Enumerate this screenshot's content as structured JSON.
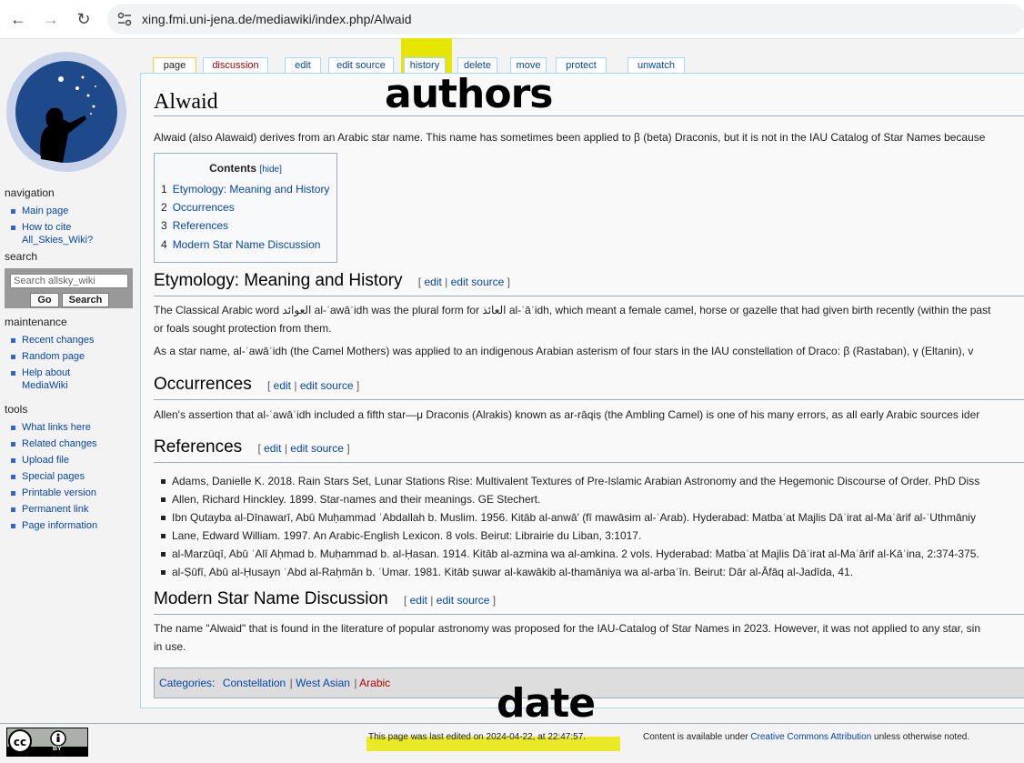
{
  "browser": {
    "url": "xing.fmi.uni-jena.de/mediawiki/index.php/Alwaid",
    "back_icon": "←",
    "forward_icon": "→",
    "reload_icon": "↻"
  },
  "sidebar": {
    "navigation_heading": "navigation",
    "navigation": [
      "Main page",
      "How to cite All_Skies_Wiki?"
    ],
    "search_heading": "search",
    "search_placeholder": "Search allsky_wiki",
    "go_label": "Go",
    "search_label": "Search",
    "maintenance_heading": "maintenance",
    "maintenance": [
      "Recent changes",
      "Random page",
      "Help about MediaWiki"
    ],
    "tools_heading": "tools",
    "tools": [
      "What links here",
      "Related changes",
      "Upload file",
      "Special pages",
      "Printable version",
      "Permanent link",
      "Page information"
    ]
  },
  "tabs": {
    "page": "page",
    "discussion": "discussion",
    "edit": "edit",
    "edit_source": "edit source",
    "history": "history",
    "delete": "delete",
    "move": "move",
    "protect": "protect",
    "unwatch": "unwatch"
  },
  "annotations": {
    "authors": "authors",
    "date": "date"
  },
  "article": {
    "title": "Alwaid",
    "intro": "Alwaid (also Alawaid) derives from an Arabic star name. This name has sometimes been applied to β (beta) Draconis, but it is not in the IAU Catalog of Star Names because",
    "toc": {
      "title": "Contents",
      "hide": "[hide]",
      "items": [
        {
          "num": "1",
          "label": "Etymology: Meaning and History"
        },
        {
          "num": "2",
          "label": "Occurrences"
        },
        {
          "num": "3",
          "label": "References"
        },
        {
          "num": "4",
          "label": "Modern Star Name Discussion"
        }
      ]
    },
    "edit_label": "edit",
    "edit_source_label": "edit source",
    "etymology": {
      "heading": "Etymology: Meaning and History",
      "p1a": "The Classical Arabic word العوائد al-ʿawāʾidh was the plural form for العائذ al-ʿāʾidh, which meant a female camel, horse or gazelle that had given birth recently (within the past",
      "p1b": "or foals sought protection from them.",
      "p2": "As a star name, al-ʿawāʾidh (the Camel Mothers) was applied to an indigenous Arabian asterism of four stars in the IAU constellation of Draco: β (Rastaban), γ (Eltanin), v"
    },
    "occurrences": {
      "heading": "Occurrences",
      "p1": "Allen's assertion that al-ʿawāʾidh included a fifth star—μ Draconis (Alrakis) known as ar-rāqiṣ (the Ambling Camel) is one of his many errors, as all early Arabic sources ider"
    },
    "references": {
      "heading": "References",
      "items": [
        "Adams, Danielle K. 2018. Rain Stars Set, Lunar Stations Rise: Multivalent Textures of Pre-Islamic Arabian Astronomy and the Hegemonic Discourse of Order. PhD Diss",
        "Allen, Richard Hinckley. 1899. Star-names and their meanings. GE Stechert.",
        "Ibn Qutayba al-Dīnawarī, Abū Muḥammad ʿAbdallah b. Muslim. 1956. Kitāb al-anwā' (fī mawāsim al-ʿArab). Hyderabad: Matbaʿat Majlis Dāʾirat al-Maʿārif al-ʿUthmāniy",
        "Lane, Edward William. 1997. An Arabic-English Lexicon. 8 vols. Beirut: Librairie du Liban, 3:1017.",
        "al-Marzūqī, Abū ʿAlī Aḥmad b. Muḥammad b. al-Ḥasan. 1914. Kitāb al-azmina wa al-amkina. 2 vols. Hyderabad: Matbaʿat Majlis Dāʾirat al-Maʿārif al-Kāʾina, 2:374-375.",
        "al-Ṣūfī, Abū al-Ḥusayn ʿAbd al-Raḥmān b. ʿUmar. 1981. Kitāb ṣuwar al-kawākib al-thamāniya wa al-arbaʿīn. Beirut: Dār al-Āfāq al-Jadīda, 41."
      ]
    },
    "modern": {
      "heading": "Modern Star Name Discussion",
      "p1a": "The name \"Alwaid\" that is found in the literature of popular astronomy was proposed for the IAU-Catalog of Star Names in 2023. However, it was not applied to any star, sin",
      "p1b": "in use."
    },
    "categories": {
      "label": "Categories:",
      "items": [
        "Constellation",
        "West Asian",
        "Arabic"
      ]
    }
  },
  "footer": {
    "last_edited": "This page was last edited on 2024-04-22, at 22:47:57.",
    "license_prefix": "Content is available under",
    "license_link": "Creative Commons Attribution",
    "license_suffix": "unless otherwise noted.",
    "badge_by": "BY"
  },
  "colors": {
    "link": "#0645ad",
    "newlink": "#ba0000",
    "highlight": "#e6e600"
  }
}
